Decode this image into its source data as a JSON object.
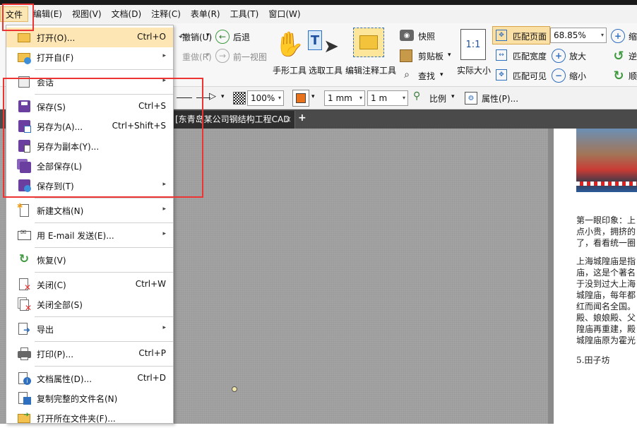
{
  "menubar": {
    "items": [
      "文件",
      "编辑(E)",
      "视图(V)",
      "文档(D)",
      "注释(C)",
      "表单(R)",
      "工具(T)",
      "窗口(W)"
    ]
  },
  "toolbar": {
    "undo": "撤销(U)",
    "redo": "重做(R)",
    "back": "后退",
    "prev_view": "前一视图",
    "hand": "手形工具",
    "select": "选取工具",
    "annot": "编辑注释工具",
    "snapshot": "快照",
    "clipboard": "剪贴板",
    "find": "查找",
    "actual": "实际大小",
    "fit_page": "匹配页面",
    "fit_width": "匹配宽度",
    "fit_visible": "匹配可见",
    "zoom_value": "68.85%",
    "zoom_in": "放大",
    "zoom_out": "缩小",
    "rot_ccw": "逆",
    "rot_cw": "顺",
    "shrink": "缩"
  },
  "toolbar2": {
    "opacity": "100%",
    "width1": "1 mm",
    "width2": "1 m",
    "ratio": "比例",
    "props": "属性(P)..."
  },
  "tab": {
    "title": "[东青岛某公司钢结构工程CAD"
  },
  "doc": {
    "lines": [
      "第一眼印象：上",
      "点小贵，拥挤的",
      "了，看看统一圈",
      "上海城隍庙是指",
      "庙，这是个著名",
      "于没到过大上海",
      "城隍庙，每年都",
      "红而闻名全国。",
      "殿、娘娘殿、父",
      "隍庙再重建，殿",
      "城隍庙原为霍光",
      "5.田子坊"
    ]
  },
  "file_menu": {
    "items": [
      {
        "label": "打开(O)...",
        "shortcut": "Ctrl+O",
        "sub": false
      },
      {
        "label": "打开自(F)",
        "shortcut": "",
        "sub": true
      },
      {
        "label": "会话",
        "shortcut": "",
        "sub": true
      },
      {
        "label": "保存(S)",
        "shortcut": "Ctrl+S",
        "sub": false
      },
      {
        "label": "另存为(A)...",
        "shortcut": "Ctrl+Shift+S",
        "sub": false
      },
      {
        "label": "另存为副本(Y)...",
        "shortcut": "",
        "sub": false
      },
      {
        "label": "全部保存(L)",
        "shortcut": "",
        "sub": false
      },
      {
        "label": "保存到(T)",
        "shortcut": "",
        "sub": true
      },
      {
        "label": "新建文档(N)",
        "shortcut": "",
        "sub": true
      },
      {
        "label": "用 E-mail 发送(E)...",
        "shortcut": "",
        "sub": true
      },
      {
        "label": "恢复(V)",
        "shortcut": "",
        "sub": false
      },
      {
        "label": "关闭(C)",
        "shortcut": "Ctrl+W",
        "sub": false
      },
      {
        "label": "关闭全部(S)",
        "shortcut": "",
        "sub": false
      },
      {
        "label": "导出",
        "shortcut": "",
        "sub": true
      },
      {
        "label": "打印(P)...",
        "shortcut": "Ctrl+P",
        "sub": false
      },
      {
        "label": "文档属性(D)...",
        "shortcut": "Ctrl+D",
        "sub": false
      },
      {
        "label": "复制完整的文件名(N)",
        "shortcut": "",
        "sub": false
      },
      {
        "label": "打开所在文件夹(F)...",
        "shortcut": "",
        "sub": false
      }
    ]
  },
  "glyphs": {
    "submenu_arrow": "▸",
    "dropdown_arrow": "▾",
    "tab_close": "×",
    "tab_add": "+"
  },
  "colors": {
    "highlight_box": "#ee3333",
    "menu_hover": "#fde6b3"
  }
}
